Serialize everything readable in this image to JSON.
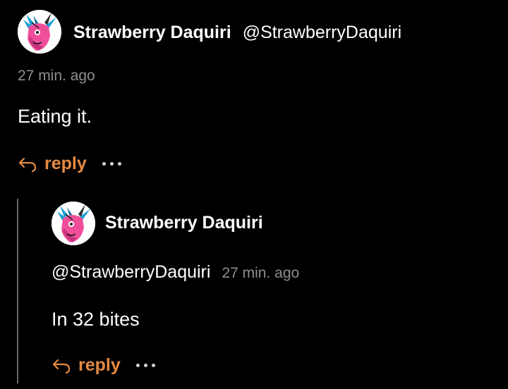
{
  "colors": {
    "background": "#000000",
    "accent": "#e48a43",
    "muted": "#8e8e8e",
    "thread_line": "#6a6a6a"
  },
  "post": {
    "author": "Strawberry Daquiri",
    "handle": "@StrawberryDaquiri",
    "time": "27 min. ago",
    "text": "Eating it.",
    "reply_label": "reply",
    "avatar_icon": "pink-dragon-avatar-icon",
    "reply_icon": "reply-arrow-icon",
    "more_icon": "more-dots-icon"
  },
  "reply": {
    "author": "Strawberry Daquiri",
    "handle": "@StrawberryDaquiri",
    "time": "27 min. ago",
    "text": "In 32 bites",
    "reply_label": "reply",
    "avatar_icon": "pink-dragon-avatar-icon",
    "reply_icon": "reply-arrow-icon",
    "more_icon": "more-dots-icon"
  }
}
